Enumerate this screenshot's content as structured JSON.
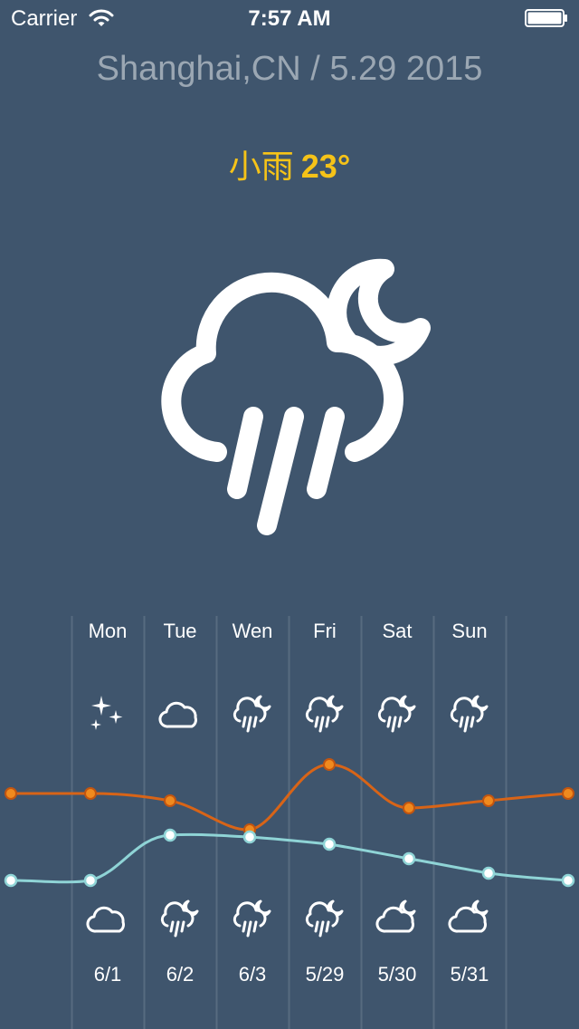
{
  "status_bar": {
    "carrier": "Carrier",
    "time": "7:57 AM",
    "wifi_icon": "wifi-icon",
    "battery_icon": "battery-icon"
  },
  "header": {
    "location": "Shanghai,CN / 5.29 2015",
    "condition": "小雨",
    "temperature": "23°"
  },
  "colors": {
    "background": "#3f556d",
    "accent_yellow": "#f6c318",
    "high_line": "#d86417",
    "low_line": "#8fd4d6",
    "location_text": "#9ba7b3",
    "divider": "#576b80"
  },
  "current_icon": "cloud-rain-moon-icon",
  "forecast": {
    "days": [
      {
        "day": "Mon",
        "date": "6/1",
        "top_icon": "stars-icon",
        "bottom_icon": "cloud-icon"
      },
      {
        "day": "Tue",
        "date": "6/2",
        "top_icon": "cloud-icon",
        "bottom_icon": "cloud-rain-moon-icon"
      },
      {
        "day": "Wen",
        "date": "6/3",
        "top_icon": "cloud-rain-moon-icon",
        "bottom_icon": "cloud-rain-moon-icon"
      },
      {
        "day": "Fri",
        "date": "5/29",
        "top_icon": "cloud-rain-moon-icon",
        "bottom_icon": "cloud-rain-moon-icon"
      },
      {
        "day": "Sat",
        "date": "5/30",
        "top_icon": "cloud-rain-moon-icon",
        "bottom_icon": "cloud-moon-icon"
      },
      {
        "day": "Sun",
        "date": "5/31",
        "top_icon": "cloud-rain-moon-icon",
        "bottom_icon": "cloud-moon-icon"
      }
    ]
  }
}
